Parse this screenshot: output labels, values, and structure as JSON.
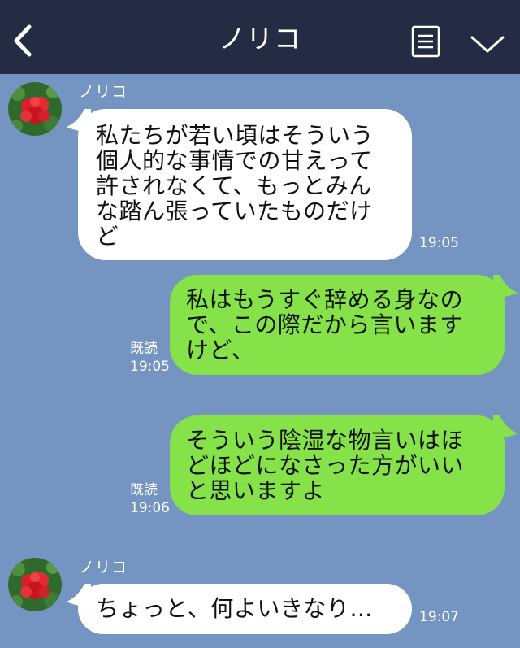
{
  "header": {
    "title": "ノリコ",
    "back_icon": "chevron-left-icon",
    "menu_icon": "document-list-icon",
    "dropdown_icon": "chevron-down-icon"
  },
  "colors": {
    "header_bg": "#232c43",
    "chat_bg": "#7494c1",
    "incoming_bubble": "#ffffff",
    "outgoing_bubble": "#85e249",
    "text": "#111111"
  },
  "messages": [
    {
      "direction": "incoming",
      "sender": "ノリコ",
      "text": "私たちが若い頃はそういう\n個人的な事情での甘えって\n許されなくて、もっとみん\nな踏ん張っていたものだけ\nど",
      "time": "19:05"
    },
    {
      "direction": "outgoing",
      "read_label": "既読",
      "text": "私はもうすぐ辞める身なの\nで、この際だから言います\nけど、",
      "time": "19:05"
    },
    {
      "direction": "outgoing",
      "read_label": "既読",
      "text": "そういう陰湿な物言いはほ\nどほどになさった方がいい\nと思いますよ",
      "time": "19:06"
    },
    {
      "direction": "incoming",
      "sender": "ノリコ",
      "text": "ちょっと、何よいきなり…",
      "time": "19:07"
    }
  ]
}
